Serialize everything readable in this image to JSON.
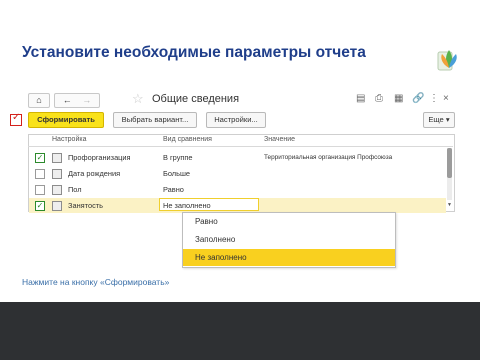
{
  "slide": {
    "title": "Установите необходимые параметры отчета",
    "caption": "Нажмите на кнопку «Сформировать»"
  },
  "window": {
    "title": "Общие сведения",
    "nav": {
      "home": "⌂",
      "back": "←",
      "forward": "→"
    },
    "toolbar_icons": [
      "save-icon",
      "print-icon",
      "preview-icon",
      "link-icon",
      "more-icon",
      "close-icon"
    ]
  },
  "toolbar": {
    "generate": "Сформировать",
    "choose_variant": "Выбрать вариант...",
    "settings": "Настройки...",
    "more": "Еще"
  },
  "table": {
    "headers": {
      "setting": "Настройка",
      "comparison": "Вид сравнения",
      "value": "Значение"
    },
    "rows": [
      {
        "checked": true,
        "setting": "Профорганизация",
        "comparison": "В группе",
        "value": "Территориальная организация Профсоюза"
      },
      {
        "checked": false,
        "setting": "Дата рождения",
        "comparison": "Больше",
        "value": ""
      },
      {
        "checked": false,
        "setting": "Пол",
        "comparison": "Равно",
        "value": ""
      },
      {
        "checked": true,
        "setting": "Занятость",
        "comparison": "Не заполнено",
        "value": ""
      }
    ]
  },
  "dropdown": {
    "items": [
      "Равно",
      "Заполнено",
      "Не заполнено"
    ],
    "selected": "Не заполнено"
  },
  "colors": {
    "accent_yellow": "#f9e21b",
    "title_blue": "#1f3e8a",
    "caption_blue": "#3a6fa8",
    "red_marker": "#d4211b"
  }
}
